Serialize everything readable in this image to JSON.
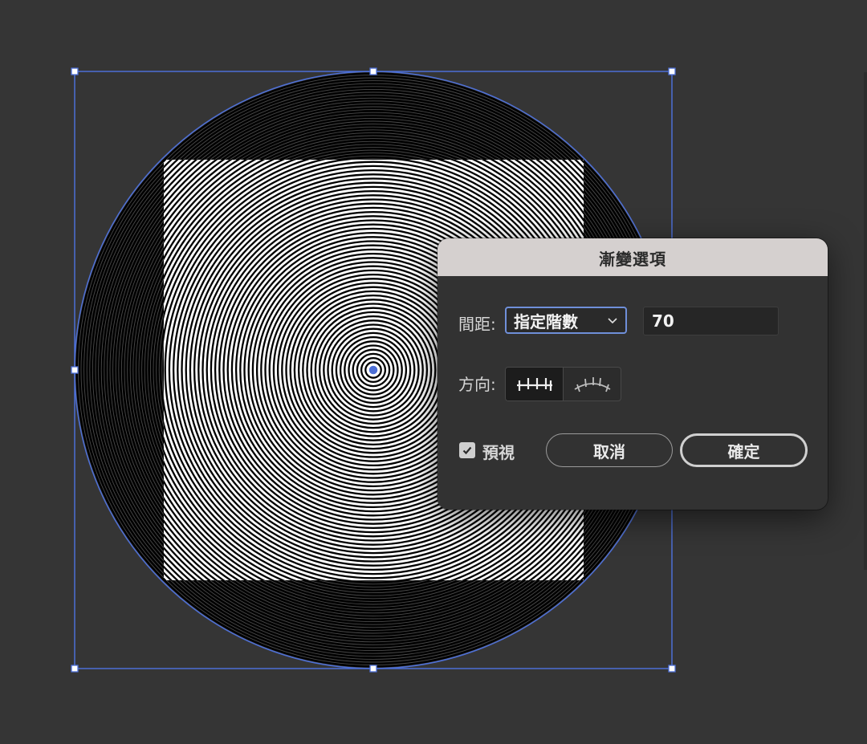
{
  "dialog": {
    "title": "漸變選項",
    "spacing_label": "間距:",
    "spacing_mode": "指定階數",
    "steps_value": "70",
    "direction_label": "方向:",
    "direction_options": [
      "align-to-page",
      "align-to-path"
    ],
    "direction_selected": "align-to-page",
    "preview_label": "預視",
    "preview_checked": true,
    "cancel_label": "取消",
    "ok_label": "確定"
  },
  "artwork": {
    "shapes": [
      "circle",
      "square"
    ],
    "outer_color": "#000000",
    "stripe_color": "#ffffff",
    "selection_color": "#4d6fd6",
    "background_color": "#353535"
  },
  "icons": {
    "chevron": "chevron-down-icon",
    "align_page": "align-to-page-icon",
    "align_path": "align-to-path-icon",
    "checkmark": "checkmark-icon"
  }
}
